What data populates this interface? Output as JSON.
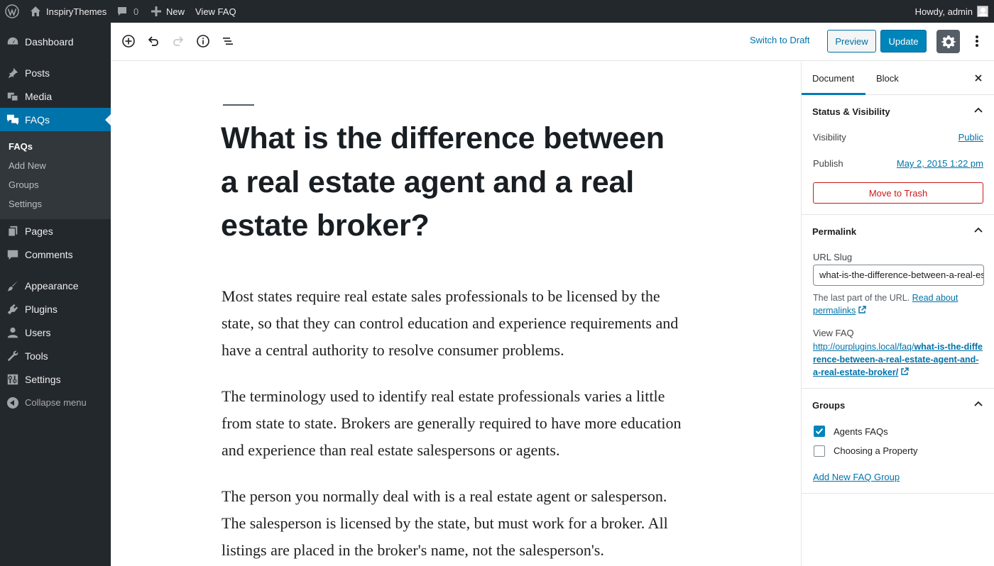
{
  "admin_bar": {
    "site_name": "InspiryThemes",
    "comments_count": "0",
    "new_label": "New",
    "view_label": "View FAQ",
    "greeting": "Howdy, admin"
  },
  "admin_menu": {
    "items": [
      {
        "label": "Dashboard",
        "icon": "dashboard-icon"
      },
      {
        "label": "Posts",
        "icon": "pin-icon"
      },
      {
        "label": "Media",
        "icon": "media-icon"
      },
      {
        "label": "FAQs",
        "icon": "faq-icon"
      },
      {
        "label": "Pages",
        "icon": "pages-icon"
      },
      {
        "label": "Comments",
        "icon": "comments-icon"
      },
      {
        "label": "Appearance",
        "icon": "brush-icon"
      },
      {
        "label": "Plugins",
        "icon": "plugin-icon"
      },
      {
        "label": "Users",
        "icon": "user-icon"
      },
      {
        "label": "Tools",
        "icon": "wrench-icon"
      },
      {
        "label": "Settings",
        "icon": "settings-icon"
      }
    ],
    "submenu": [
      "FAQs",
      "Add New",
      "Groups",
      "Settings"
    ],
    "collapse_label": "Collapse menu",
    "accent": "#0073aa"
  },
  "toolbar": {
    "switch_to_draft": "Switch to Draft",
    "preview": "Preview",
    "update": "Update"
  },
  "post": {
    "title": "What is the difference between a real estate agent and a real estate broker?",
    "paragraphs": [
      "Most states require real estate sales professionals to be licensed by the state, so that they can control education and experience requirements and have a central authority to resolve consumer problems.",
      "The terminology used to identify real estate professionals varies a little from state to state. Brokers are generally required to have more education and experience than real estate salespersons or agents.",
      "The person you normally deal with is a real estate agent or salesperson. The salesperson is licensed by the state, but must work for a broker. All listings are placed in the broker's name, not the salesperson's."
    ]
  },
  "sidebar": {
    "tabs": [
      "Document",
      "Block"
    ],
    "status": {
      "heading": "Status & Visibility",
      "visibility_label": "Visibility",
      "visibility_value": "Public",
      "publish_label": "Publish",
      "publish_value": "May 2, 2015 1:22 pm",
      "trash_label": "Move to Trash"
    },
    "permalink": {
      "heading": "Permalink",
      "slug_label": "URL Slug",
      "slug_value": "what-is-the-difference-between-a-real-estate-agent-and-a-real-estate-broker",
      "help_text": "The last part of the URL.",
      "help_link": "Read about permalinks",
      "view_label": "View FAQ",
      "url_prefix": "http://ourplugins.local/faq/",
      "url_slug": "what-is-the-difference-between-a-real-estate-agent-and-a-real-estate-broker/"
    },
    "groups": {
      "heading": "Groups",
      "items": [
        {
          "label": "Agents FAQs",
          "checked": true
        },
        {
          "label": "Choosing a Property",
          "checked": false
        }
      ],
      "add_link": "Add New FAQ Group"
    }
  }
}
